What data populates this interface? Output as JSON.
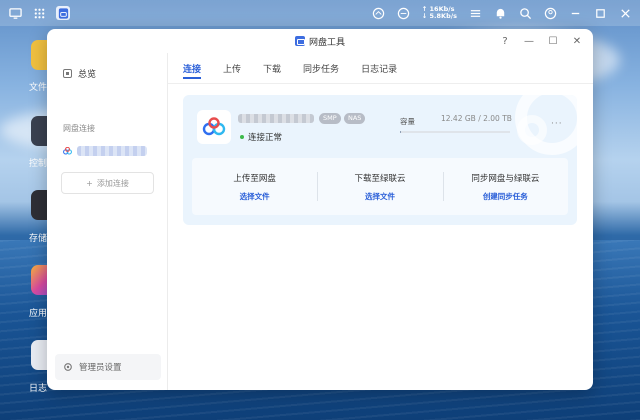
{
  "window": {
    "title": "网盘工具",
    "controls": [
      "?",
      "—",
      "☐",
      "✕"
    ]
  },
  "sysbar": {
    "upload_speed": "↑ 16Kb/s",
    "download_speed": "↓ 5.8Kb/s"
  },
  "desktop": {
    "items": [
      {
        "label": "文件"
      },
      {
        "label": "控制"
      },
      {
        "label": "存储"
      },
      {
        "label": "应用"
      },
      {
        "label": "日志"
      }
    ]
  },
  "sidebar": {
    "overview": "总览",
    "section": "网盘连接",
    "add_button": "添加连接",
    "admin": "管理员设置"
  },
  "tabs": [
    "连接",
    "上传",
    "下载",
    "同步任务",
    "日志记录"
  ],
  "card": {
    "badges": [
      "SMP",
      "NAS"
    ],
    "status": "连接正常",
    "capacity_label": "容量",
    "capacity_value": "12.42 GB / 2.00 TB",
    "capacity_fraction": 0.006,
    "more": "···",
    "actions": [
      {
        "title": "上传至网盘",
        "link": "选择文件"
      },
      {
        "title": "下载至绿联云",
        "link": "选择文件"
      },
      {
        "title": "同步网盘与绿联云",
        "link": "创建同步任务"
      }
    ]
  }
}
